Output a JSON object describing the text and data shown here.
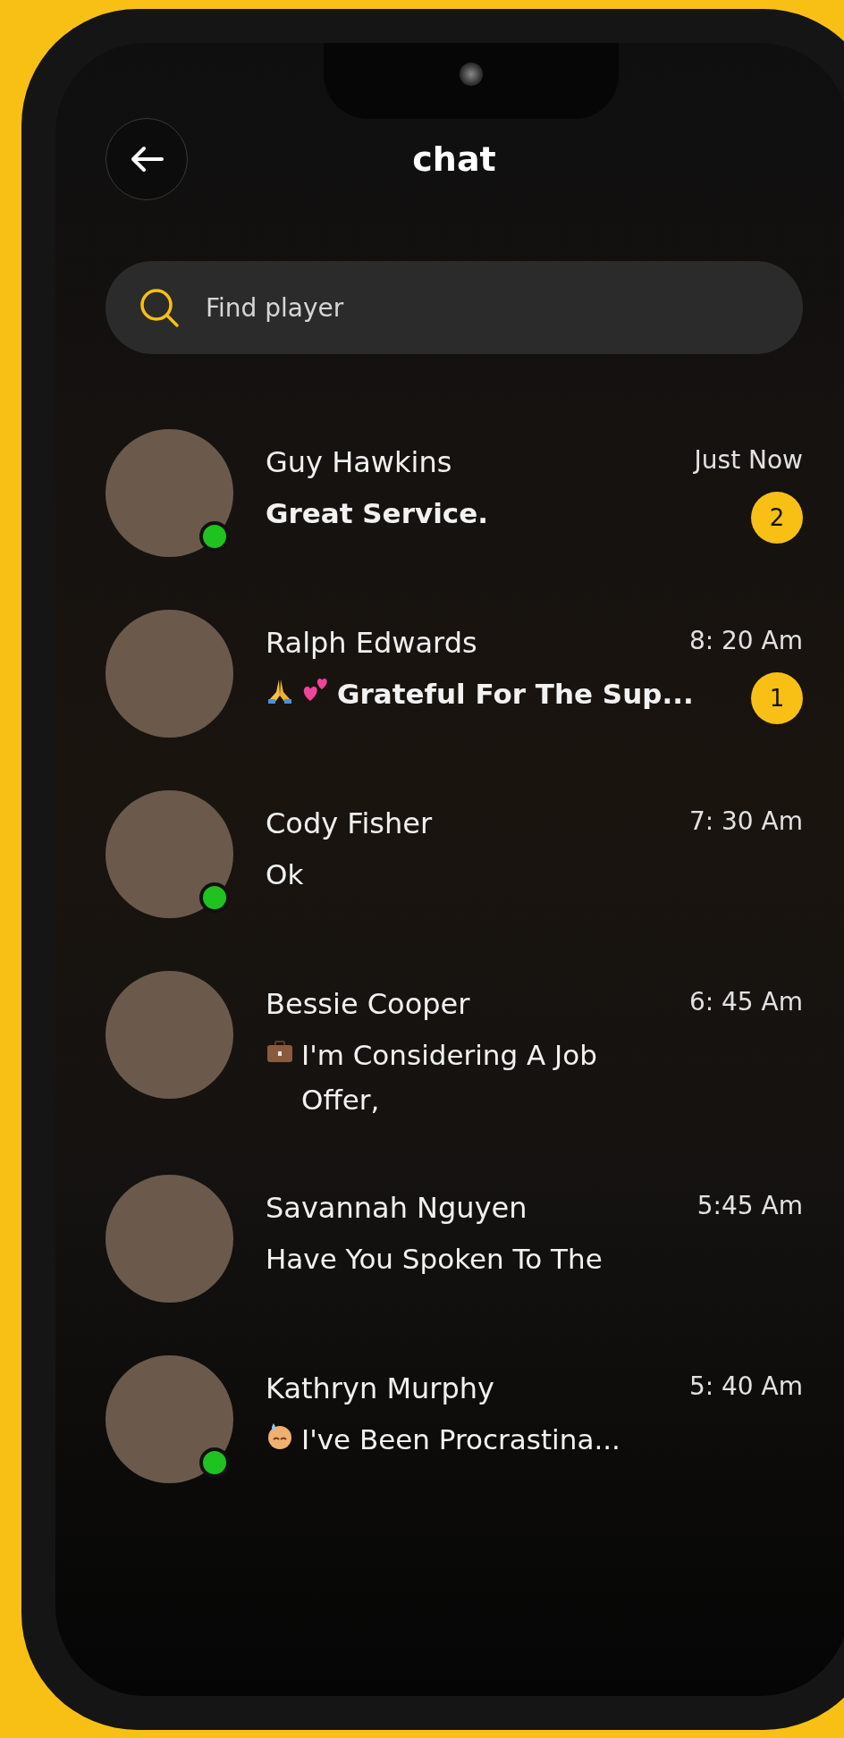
{
  "header": {
    "title": "chat"
  },
  "search": {
    "placeholder": "Find player"
  },
  "chats": [
    {
      "name": "Guy Hawkins",
      "time": "Just Now",
      "message": "Great Service.",
      "unread": true,
      "badge": "2",
      "online": true
    },
    {
      "name": "Ralph Edwards",
      "time": "8: 20 Am",
      "message": "Grateful For The Sup...",
      "lead_icons": [
        {
          "kind": "folded-hands"
        },
        {
          "kind": "two-hearts"
        }
      ],
      "unread": true,
      "badge": "1",
      "online": false
    },
    {
      "name": "Cody Fisher",
      "time": "7: 30 Am",
      "message": "Ok",
      "unread": false,
      "online": true
    },
    {
      "name": "Bessie Cooper",
      "time": "6: 45 Am",
      "message": "I'm Considering A Job\nOffer,",
      "lead_icons": [
        {
          "kind": "briefcase"
        }
      ],
      "unread": false,
      "online": false
    },
    {
      "name": "Savannah Nguyen",
      "time": "5:45 Am",
      "message": "Have You Spoken To The",
      "unread": false,
      "online": false
    },
    {
      "name": "Kathryn Murphy",
      "time": "5: 40 Am",
      "message": "I've Been Procrastina...",
      "lead_icons": [
        {
          "kind": "sweat-face"
        }
      ],
      "unread": false,
      "online": true
    }
  ]
}
